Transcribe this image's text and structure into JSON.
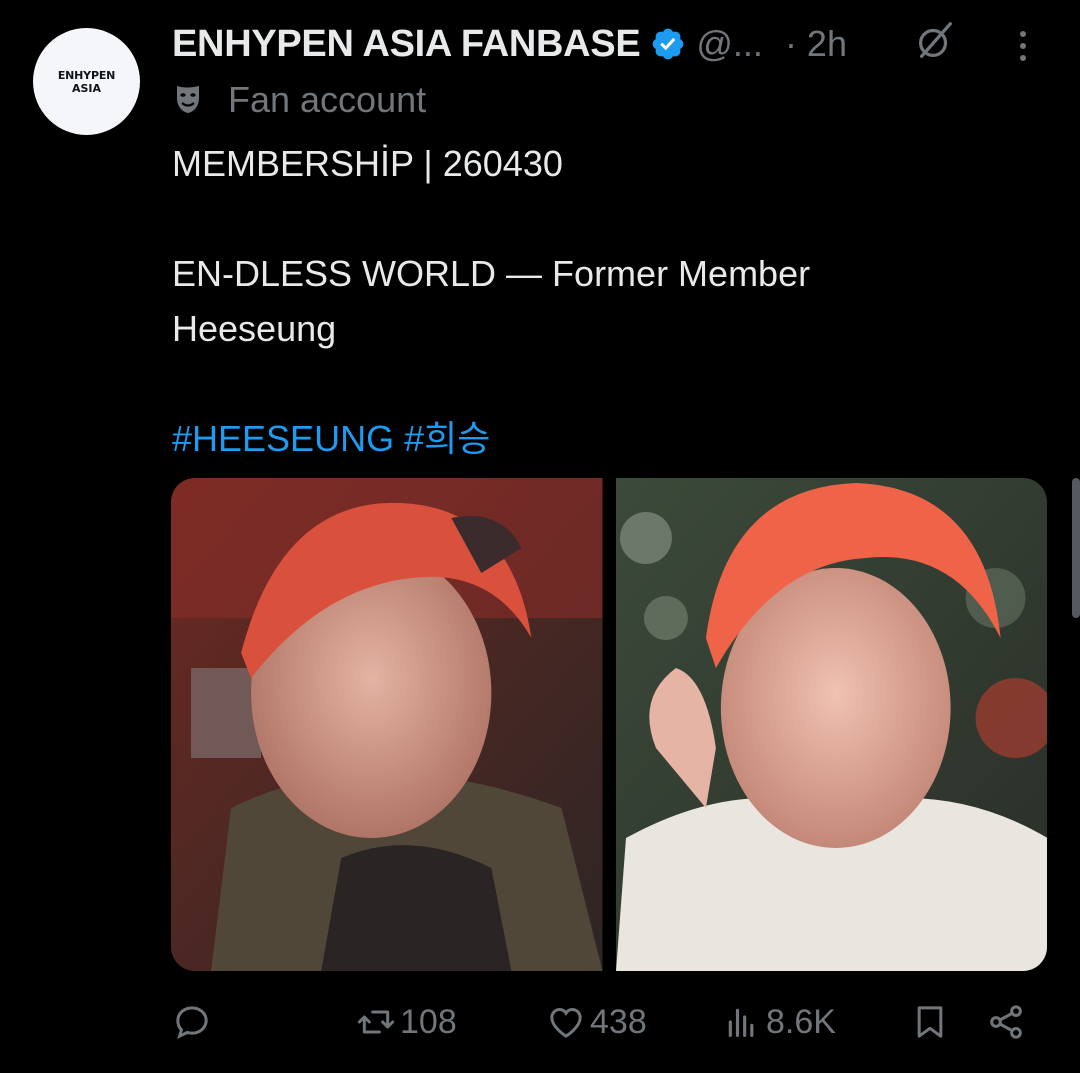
{
  "avatar": {
    "line1": "ENHYPEN",
    "line2": "ASIA"
  },
  "header": {
    "display_name": "ENHYPEN ASIA FANBASE",
    "verified_icon": "verified-badge-icon",
    "handle": "@...",
    "time": "· 2h",
    "grok_icon": "grok-icon",
    "more_icon": "more-vertical-icon"
  },
  "label": {
    "icon": "theater-masks-icon",
    "text": "Fan account"
  },
  "post": {
    "line1": "MEMBERSHİP | 260430",
    "line2": "EN-DLESS WORLD — Former Member",
    "line3": "Heeseung",
    "hashtag1": "#HEESEUNG",
    "hashtag2": "#희승"
  },
  "media": {
    "count": 2
  },
  "actions": {
    "reply": {
      "icon": "reply-icon",
      "count": ""
    },
    "repost": {
      "icon": "repost-icon",
      "count": "108"
    },
    "like": {
      "icon": "heart-icon",
      "count": "438"
    },
    "views": {
      "icon": "views-chart-icon",
      "count": "8.6K"
    },
    "bookmark": {
      "icon": "bookmark-icon"
    },
    "share": {
      "icon": "share-icon"
    }
  },
  "colors": {
    "background": "#000000",
    "text_primary": "#e7e9ea",
    "text_secondary": "#71767b",
    "accent": "#1d9bf0"
  }
}
